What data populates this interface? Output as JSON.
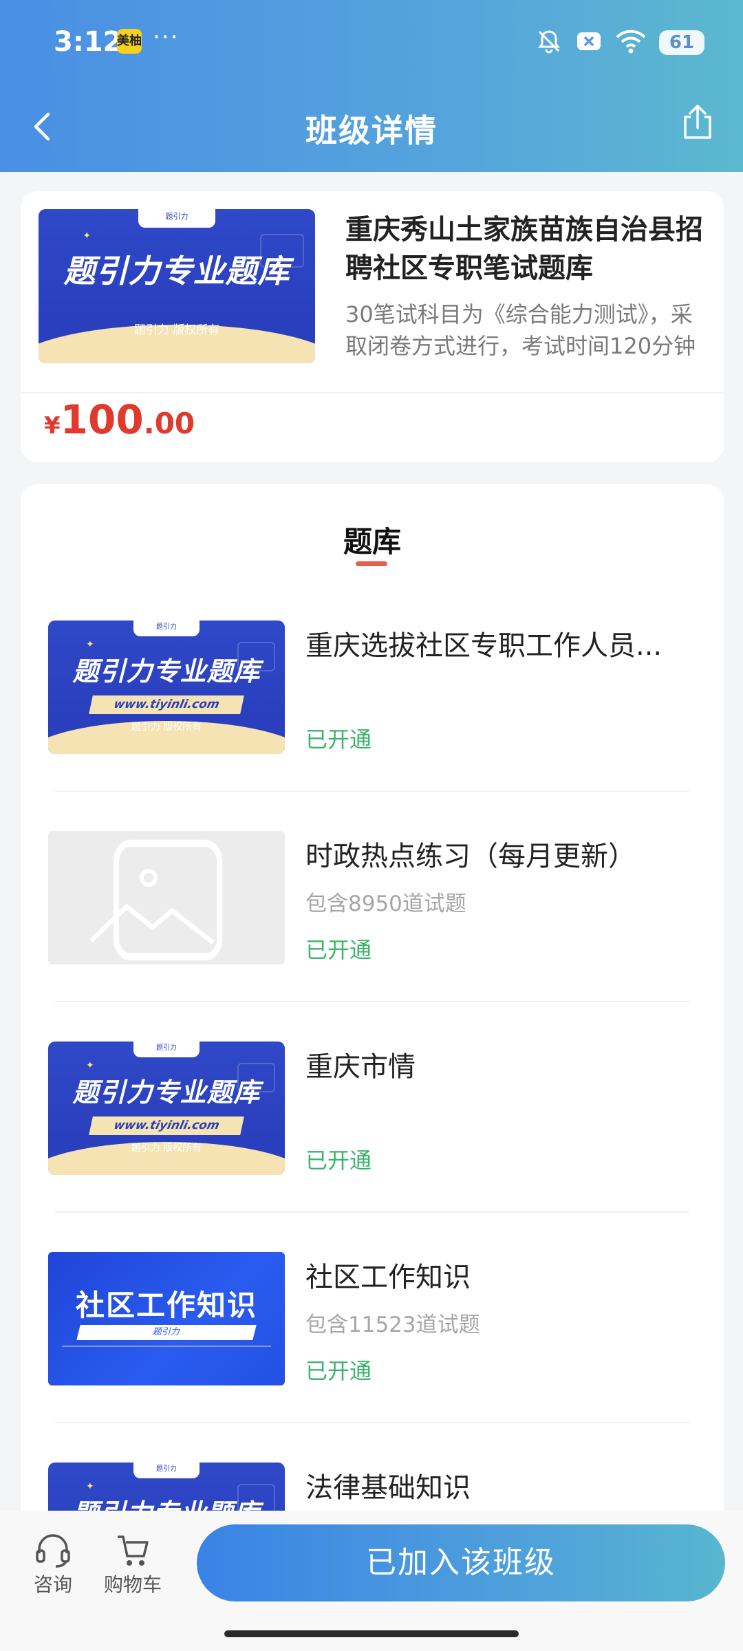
{
  "status_bar": {
    "time": "3:12",
    "app_badge": "美柚",
    "dots": "···",
    "battery": "61",
    "icons": [
      "bell-muted-icon",
      "close-box-icon",
      "wifi-icon",
      "battery-icon"
    ]
  },
  "header": {
    "title": "班级详情",
    "back_icon": "chevron-left-icon",
    "share_icon": "share-icon",
    "gradient": [
      "#4a8fe4",
      "#5cb8cf"
    ]
  },
  "product": {
    "cover": {
      "tab": "题引力",
      "title": "题引力专业题库",
      "copyright": "题引力 版权所有"
    },
    "name": "重庆秀山土家族苗族自治县招聘社区专职笔试题库",
    "description": "30笔试科目为《综合能力测试》，采取闭卷方式进行，考试时间120分钟",
    "price": {
      "symbol": "¥",
      "integer": "100",
      "decimal": ".00",
      "color": "#e03a2e"
    }
  },
  "bank": {
    "section_title": "题库",
    "items": [
      {
        "title": "重庆选拔社区专职工作人员...",
        "count": "",
        "status": "已开通",
        "cover": {
          "tab": "题引力",
          "title": "题引力专业题库",
          "url": "www.tiyinli.com",
          "copyright": "题引力 版权所有"
        }
      },
      {
        "title": "时政热点练习（每月更新）",
        "count": "包含8950道试题",
        "status": "已开通",
        "cover": null
      },
      {
        "title": "重庆市情",
        "count": "",
        "status": "已开通",
        "cover": {
          "tab": "题引力",
          "title": "题引力专业题库",
          "url": "www.tiyinli.com",
          "copyright": "题引力 版权所有"
        }
      },
      {
        "title": "社区工作知识",
        "count": "包含11523道试题",
        "status": "已开通",
        "cover": {
          "title": "社区工作知识",
          "strip": "题引力"
        }
      },
      {
        "title": "法律基础知识",
        "count": "",
        "status": "",
        "cover": {
          "tab": "题引力",
          "title": "题引力专业题库"
        }
      }
    ],
    "status_color": "#3cb36a"
  },
  "bottom_bar": {
    "consult_label": "咨询",
    "cart_label": "购物车",
    "join_label": "已加入该班级",
    "consult_icon": "headset-icon",
    "cart_icon": "cart-icon"
  }
}
